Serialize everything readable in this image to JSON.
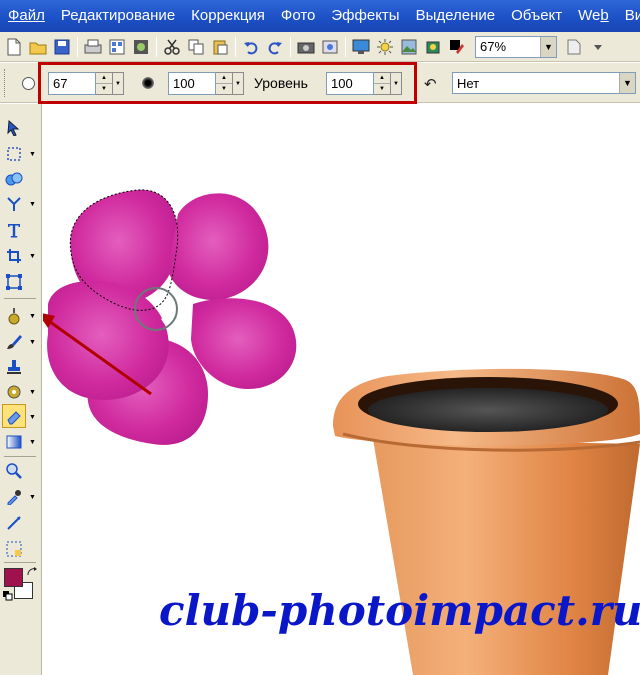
{
  "menu": {
    "items": [
      "Файл",
      "Редактирование",
      "Коррекция",
      "Фото",
      "Эффекты",
      "Выделение",
      "Объект",
      "Web",
      "Ви"
    ],
    "underline_index": [
      0,
      0,
      0,
      0,
      0,
      0,
      0,
      2,
      0
    ]
  },
  "toolbar": {
    "zoom_value": "67%",
    "buttons": [
      "new-icon",
      "open-icon",
      "save-icon",
      "scan-icon",
      "browse-icon",
      "capture-icon",
      "cut-icon",
      "copy-icon",
      "paste-icon",
      "undo-icon",
      "redo-icon",
      "camera-icon",
      "slideshow-icon",
      "screen-icon",
      "sun-icon",
      "image-icon",
      "magic-icon",
      "pen-icon",
      "brush-set-icon"
    ]
  },
  "attributes": {
    "size_value": "67",
    "softness_value": "100",
    "level_label": "Уровень",
    "level_value": "100",
    "mode_value": "Нет"
  },
  "colors": {
    "menubar": "#1b4fc4",
    "highlight": "#c00000",
    "foreground": "#a0124e",
    "background": "#ffffff",
    "flower": "#d4279f",
    "pot": "#e08a4a",
    "watermark": "#0a17c9"
  },
  "tools": [
    "pick-icon",
    "selection-icon",
    "bezier-icon",
    "crop-lasso-icon",
    "text-icon",
    "crop-icon",
    "transform-icon",
    "dodge-icon",
    "brush-icon",
    "stamp-icon",
    "retouch-icon",
    "eraser-icon",
    "fill-icon",
    "zoom-icon",
    "eyedropper-icon",
    "line-icon",
    "path-icon"
  ],
  "canvas": {
    "watermark": "club-photoimpact.ru"
  }
}
